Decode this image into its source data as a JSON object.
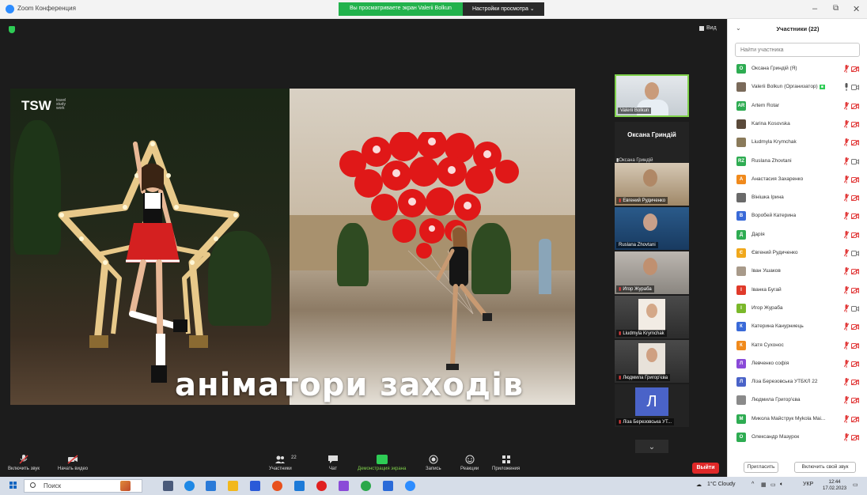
{
  "window": {
    "title": "Zoom Конференция",
    "banner_viewing": "Вы просматриваете экран Valerii Bolkun",
    "banner_options": "Настройки просмотра ⌄",
    "view_label": "Вид"
  },
  "share": {
    "logo": "TSW",
    "logo_sub": "travel study work",
    "caption": "аніматори заходів"
  },
  "video_strip": {
    "tiles": [
      {
        "name": "Valerii Bolkun",
        "muted": false
      },
      {
        "name": "Оксана Гриндій",
        "muted": true,
        "text_only": true
      },
      {
        "name": "Евгений Рудиченко",
        "muted": true
      },
      {
        "name": "Ruslana Zhovtani",
        "muted": false
      },
      {
        "name": "Игор Жураба",
        "muted": true
      },
      {
        "name": "Liudmyla Krymchak",
        "muted": true
      },
      {
        "name": "Людмила Григор'єва",
        "muted": true
      },
      {
        "name": "Лiза Березовська УТ...",
        "muted": true,
        "avatar": "Л"
      }
    ]
  },
  "toolbar": {
    "unmute": "Включить звук",
    "start_video": "Начать видео",
    "participants": "Участники",
    "participants_count": "22",
    "chat": "Чат",
    "share_screen": "Демонстрация экрана",
    "record": "Запись",
    "reactions": "Реакции",
    "apps": "Приложения",
    "leave": "Выйти"
  },
  "panel": {
    "title": "Участники (22)",
    "search_placeholder": "Найти участника",
    "invite": "Пригласить",
    "unmute_self": "Включить свой звук",
    "participants": [
      {
        "initials": "О",
        "color": "#2eac52",
        "name": "Оксана Гриндій (Я)",
        "mic": "off",
        "cam": "off"
      },
      {
        "initials": "",
        "color": "#7a6a5a",
        "name": "Valerii Bolkun (Организатор)",
        "mic": "on",
        "cam": "on",
        "host": true
      },
      {
        "initials": "AR",
        "color": "#2eac52",
        "name": "Artem Rotar",
        "mic": "off",
        "cam": "off"
      },
      {
        "initials": "",
        "color": "#5a4a3a",
        "name": "Karina Kosovska",
        "mic": "off",
        "cam": "off"
      },
      {
        "initials": "",
        "color": "#8a7a5a",
        "name": "Liudmyla Krymchak",
        "mic": "off",
        "cam": "off"
      },
      {
        "initials": "RZ",
        "color": "#2eac52",
        "name": "Ruslana Zhovtani",
        "mic": "off",
        "cam": "on"
      },
      {
        "initials": "А",
        "color": "#f08a1c",
        "name": "Анастасия Захаренко",
        "mic": "off",
        "cam": "off"
      },
      {
        "initials": "",
        "color": "#6a6a6a",
        "name": "Вінішка Ірина",
        "mic": "off",
        "cam": "off"
      },
      {
        "initials": "В",
        "color": "#3a6ad8",
        "name": "Воробей Катерина",
        "mic": "off",
        "cam": "off"
      },
      {
        "initials": "Д",
        "color": "#2eac52",
        "name": "Дарія",
        "mic": "off",
        "cam": "off"
      },
      {
        "initials": "Є",
        "color": "#f0a81c",
        "name": "Євгений Рудиченко",
        "mic": "off",
        "cam": "on"
      },
      {
        "initials": "",
        "color": "#a89a8a",
        "name": "Іван Ушаков",
        "mic": "off",
        "cam": "off"
      },
      {
        "initials": "І",
        "color": "#e03a2a",
        "name": "Іванка Бугай",
        "mic": "off",
        "cam": "off"
      },
      {
        "initials": "І",
        "color": "#7ab82a",
        "name": "Игор Жураба",
        "mic": "off",
        "cam": "on"
      },
      {
        "initials": "К",
        "color": "#3a6ad8",
        "name": "Катерина Канурниець",
        "mic": "off",
        "cam": "off"
      },
      {
        "initials": "К",
        "color": "#f08a1c",
        "name": "Катя Сухонос",
        "mic": "off",
        "cam": "off"
      },
      {
        "initials": "Л",
        "color": "#8a4ad8",
        "name": "Левченко софія",
        "mic": "off",
        "cam": "off"
      },
      {
        "initials": "Л",
        "color": "#4a63c8",
        "name": "Лiза Березовська УТБКЛ 22",
        "mic": "off",
        "cam": "off"
      },
      {
        "initials": "",
        "color": "#8a8a8a",
        "name": "Людмила Григор'єва",
        "mic": "off",
        "cam": "off"
      },
      {
        "initials": "М",
        "color": "#2eac52",
        "name": "Микола Майструк Mykola Mai...",
        "mic": "off",
        "cam": "off"
      },
      {
        "initials": "О",
        "color": "#2eac52",
        "name": "Олександр Мазурок",
        "mic": "off",
        "cam": "off"
      }
    ]
  },
  "taskbar": {
    "search": "Поиск",
    "weather": "1°C Cloudy",
    "lang": "УКР",
    "time": "12:44",
    "date": "17.02.2023"
  },
  "colors": {
    "zoom_blue": "#2d8cff",
    "zoom_green": "#22b24c",
    "leave_red": "#e02828",
    "muted_red": "#e23b3b"
  }
}
